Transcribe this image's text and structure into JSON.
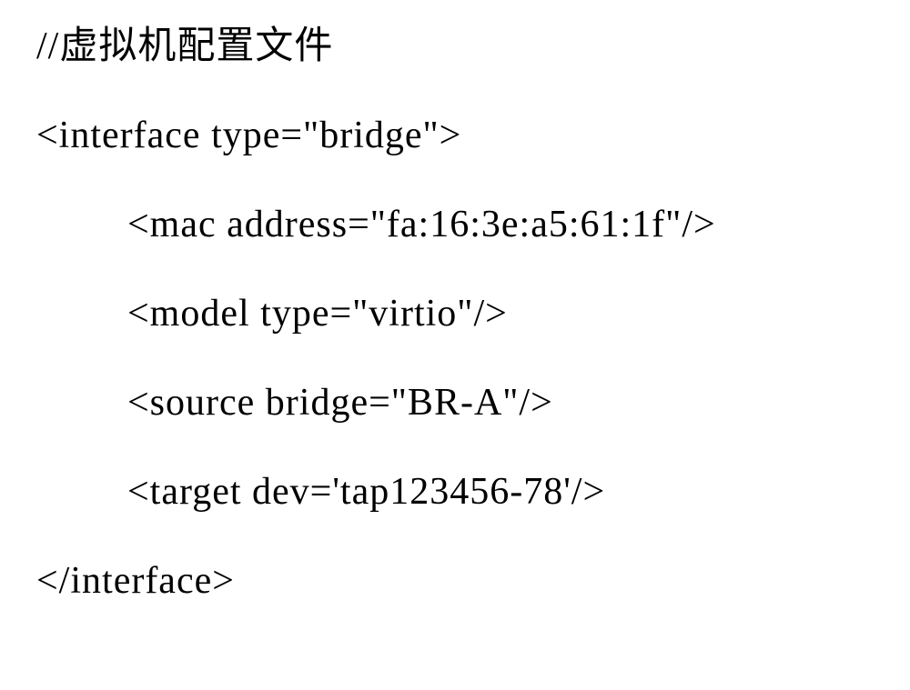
{
  "code": {
    "comment": "//虚拟机配置文件",
    "line1": "<interface type=\"bridge\">",
    "line2": "<mac address=\"fa:16:3e:a5:61:1f\"/>",
    "line3": "<model type=\"virtio\"/>",
    "line4": "<source bridge=\"BR-A\"/>",
    "line5": "<target dev='tap123456-78'/>",
    "line6": "</interface>"
  }
}
